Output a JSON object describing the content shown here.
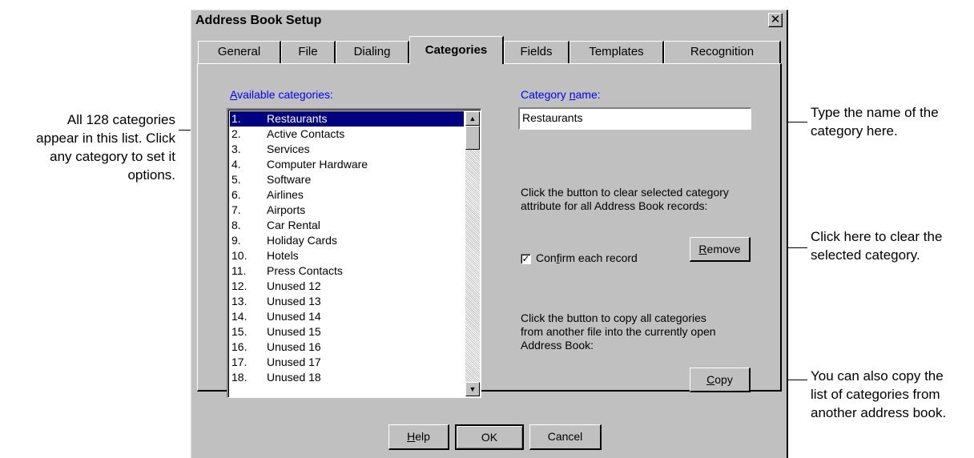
{
  "annotations": {
    "left": "All 128 categories\nappear in this list. Click\nany category to set it\noptions.",
    "right_name": "Type the name of the\ncategory here.",
    "right_remove": "Click here to clear the\nselected category.",
    "right_copy": "You can also copy the\nlist of categories from\nanother address book."
  },
  "window": {
    "title": "Address Book Setup"
  },
  "tabs": [
    {
      "label": "General"
    },
    {
      "label": "File"
    },
    {
      "label": "Dialing"
    },
    {
      "label": "Categories"
    },
    {
      "label": "Fields"
    },
    {
      "label": "Templates"
    },
    {
      "label": "Recognition"
    }
  ],
  "active_tab": "Categories",
  "available": {
    "label_mnemonic": "A",
    "label_rest": "vailable categories:",
    "items": [
      {
        "num": "1.",
        "name": "Restaurants",
        "selected": true
      },
      {
        "num": "2.",
        "name": "Active Contacts"
      },
      {
        "num": "3.",
        "name": "Services"
      },
      {
        "num": "4.",
        "name": "Computer Hardware"
      },
      {
        "num": "5.",
        "name": "Software"
      },
      {
        "num": "6.",
        "name": "Airlines"
      },
      {
        "num": "7.",
        "name": "Airports"
      },
      {
        "num": "8.",
        "name": "Car Rental"
      },
      {
        "num": "9.",
        "name": "Holiday Cards"
      },
      {
        "num": "10.",
        "name": "Hotels"
      },
      {
        "num": "11.",
        "name": "Press Contacts"
      },
      {
        "num": "12.",
        "name": "Unused 12"
      },
      {
        "num": "13.",
        "name": "Unused 13"
      },
      {
        "num": "14.",
        "name": "Unused 14"
      },
      {
        "num": "15.",
        "name": "Unused 15"
      },
      {
        "num": "16.",
        "name": "Unused 16"
      },
      {
        "num": "17.",
        "name": "Unused 17"
      },
      {
        "num": "18.",
        "name": "Unused 18"
      }
    ]
  },
  "category_name": {
    "label_before": "Category ",
    "label_mnemonic": "n",
    "label_after": "ame:",
    "value": "Restaurants"
  },
  "clear_text": "Click the button to clear selected category\nattribute for all Address Book records:",
  "confirm": {
    "before": "Con",
    "mnemonic": "f",
    "after": "irm each record",
    "checked": true
  },
  "remove_button": {
    "mnemonic": "R",
    "rest": "emove"
  },
  "copy_text": "Click the button to copy all categories\nfrom another file into the currently open\nAddress Book:",
  "copy_button": {
    "mnemonic": "C",
    "rest": "opy"
  },
  "footer": {
    "help": {
      "mnemonic": "H",
      "rest": "elp"
    },
    "ok": "OK",
    "cancel": "Cancel"
  },
  "icons": {
    "close": "close-icon",
    "check": "checkmark-icon",
    "scroll_up": "arrow-up-icon",
    "scroll_down": "arrow-down-icon"
  },
  "colors": {
    "dialog_bg": "#c0c0c0",
    "selection": "#000080",
    "label_blue": "#0000ff"
  }
}
